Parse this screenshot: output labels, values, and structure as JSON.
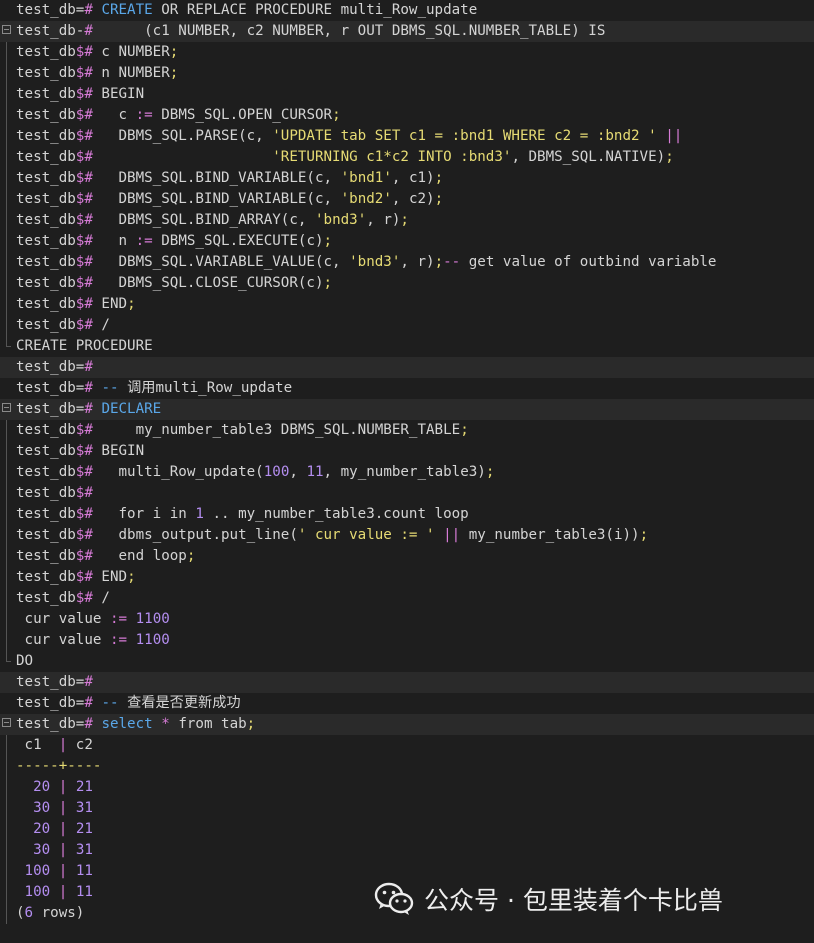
{
  "terminal": {
    "lines": [
      {
        "fold": "",
        "hl": false,
        "tokens": [
          [
            "prompt",
            "test_db="
          ],
          [
            "op",
            "#"
          ],
          [
            "text",
            " "
          ],
          [
            "kw",
            "CREATE"
          ],
          [
            "text",
            " OR REPLACE PROCEDURE multi_Row_update"
          ]
        ]
      },
      {
        "fold": "start",
        "hl": true,
        "tokens": [
          [
            "prompt",
            "test_db-"
          ],
          [
            "op",
            "#"
          ],
          [
            "text",
            "      (c1 NUMBER, c2 NUMBER, r OUT DBMS_SQL.NUMBER_TABLE) IS"
          ]
        ]
      },
      {
        "fold": "mid",
        "hl": false,
        "tokens": [
          [
            "prompt",
            "test_db"
          ],
          [
            "op",
            "$#"
          ],
          [
            "text",
            " c NUMBER"
          ],
          [
            "punc",
            ";"
          ]
        ]
      },
      {
        "fold": "mid",
        "hl": false,
        "tokens": [
          [
            "prompt",
            "test_db"
          ],
          [
            "op",
            "$#"
          ],
          [
            "text",
            " n NUMBER"
          ],
          [
            "punc",
            ";"
          ]
        ]
      },
      {
        "fold": "mid",
        "hl": false,
        "tokens": [
          [
            "prompt",
            "test_db"
          ],
          [
            "op",
            "$#"
          ],
          [
            "text",
            " BEGIN"
          ]
        ]
      },
      {
        "fold": "mid",
        "hl": false,
        "tokens": [
          [
            "prompt",
            "test_db"
          ],
          [
            "op",
            "$#"
          ],
          [
            "text",
            "   c "
          ],
          [
            "op",
            ":="
          ],
          [
            "text",
            " DBMS_SQL.OPEN_CURSOR"
          ],
          [
            "punc",
            ";"
          ]
        ]
      },
      {
        "fold": "mid",
        "hl": false,
        "tokens": [
          [
            "prompt",
            "test_db"
          ],
          [
            "op",
            "$#"
          ],
          [
            "text",
            "   DBMS_SQL.PARSE(c, "
          ],
          [
            "str",
            "'UPDATE tab SET c1 = :bnd1 WHERE c2 = :bnd2 '"
          ],
          [
            "text",
            " "
          ],
          [
            "op",
            "||"
          ]
        ]
      },
      {
        "fold": "mid",
        "hl": false,
        "tokens": [
          [
            "prompt",
            "test_db"
          ],
          [
            "op",
            "$#"
          ],
          [
            "text",
            "                     "
          ],
          [
            "str",
            "'RETURNING c1*c2 INTO :bnd3'"
          ],
          [
            "text",
            ", DBMS_SQL.NATIVE)"
          ],
          [
            "punc",
            ";"
          ]
        ]
      },
      {
        "fold": "mid",
        "hl": false,
        "tokens": [
          [
            "prompt",
            "test_db"
          ],
          [
            "op",
            "$#"
          ],
          [
            "text",
            "   DBMS_SQL.BIND_VARIABLE(c, "
          ],
          [
            "str",
            "'bnd1'"
          ],
          [
            "text",
            ", c1)"
          ],
          [
            "punc",
            ";"
          ]
        ]
      },
      {
        "fold": "mid",
        "hl": false,
        "tokens": [
          [
            "prompt",
            "test_db"
          ],
          [
            "op",
            "$#"
          ],
          [
            "text",
            "   DBMS_SQL.BIND_VARIABLE(c, "
          ],
          [
            "str",
            "'bnd2'"
          ],
          [
            "text",
            ", c2)"
          ],
          [
            "punc",
            ";"
          ]
        ]
      },
      {
        "fold": "mid",
        "hl": false,
        "tokens": [
          [
            "prompt",
            "test_db"
          ],
          [
            "op",
            "$#"
          ],
          [
            "text",
            "   DBMS_SQL.BIND_ARRAY(c, "
          ],
          [
            "str",
            "'bnd3'"
          ],
          [
            "text",
            ", r)"
          ],
          [
            "punc",
            ";"
          ]
        ]
      },
      {
        "fold": "mid",
        "hl": false,
        "tokens": [
          [
            "prompt",
            "test_db"
          ],
          [
            "op",
            "$#"
          ],
          [
            "text",
            "   n "
          ],
          [
            "op",
            ":="
          ],
          [
            "text",
            " DBMS_SQL.EXECUTE(c)"
          ],
          [
            "punc",
            ";"
          ]
        ]
      },
      {
        "fold": "mid",
        "hl": false,
        "tokens": [
          [
            "prompt",
            "test_db"
          ],
          [
            "op",
            "$#"
          ],
          [
            "text",
            "   DBMS_SQL.VARIABLE_VALUE(c, "
          ],
          [
            "str",
            "'bnd3'"
          ],
          [
            "text",
            ", r)"
          ],
          [
            "punc",
            ";"
          ],
          [
            "op",
            "--"
          ],
          [
            "text",
            " get value of outbind variable"
          ]
        ]
      },
      {
        "fold": "mid",
        "hl": false,
        "tokens": [
          [
            "prompt",
            "test_db"
          ],
          [
            "op",
            "$#"
          ],
          [
            "text",
            "   DBMS_SQL.CLOSE_CURSOR(c)"
          ],
          [
            "punc",
            ";"
          ]
        ]
      },
      {
        "fold": "mid",
        "hl": false,
        "tokens": [
          [
            "prompt",
            "test_db"
          ],
          [
            "op",
            "$#"
          ],
          [
            "text",
            " END"
          ],
          [
            "punc",
            ";"
          ]
        ]
      },
      {
        "fold": "mid",
        "hl": false,
        "tokens": [
          [
            "prompt",
            "test_db"
          ],
          [
            "op",
            "$#"
          ],
          [
            "text",
            " /"
          ]
        ]
      },
      {
        "fold": "end",
        "hl": false,
        "tokens": [
          [
            "text",
            "CREATE PROCEDURE"
          ]
        ]
      },
      {
        "fold": "",
        "hl": true,
        "tokens": [
          [
            "prompt",
            "test_db="
          ],
          [
            "op",
            "#"
          ]
        ]
      },
      {
        "fold": "",
        "hl": false,
        "tokens": [
          [
            "prompt",
            "test_db="
          ],
          [
            "op",
            "#"
          ],
          [
            "text",
            " "
          ],
          [
            "cm",
            "--"
          ],
          [
            "text",
            " 调用multi_Row_update"
          ]
        ]
      },
      {
        "fold": "start",
        "hl": true,
        "tokens": [
          [
            "prompt",
            "test_db="
          ],
          [
            "op",
            "#"
          ],
          [
            "text",
            " "
          ],
          [
            "kw",
            "DECLARE"
          ]
        ]
      },
      {
        "fold": "mid",
        "hl": false,
        "tokens": [
          [
            "prompt",
            "test_db"
          ],
          [
            "op",
            "$#"
          ],
          [
            "text",
            "     my_number_table3 DBMS_SQL.NUMBER_TABLE"
          ],
          [
            "punc",
            ";"
          ]
        ]
      },
      {
        "fold": "mid",
        "hl": false,
        "tokens": [
          [
            "prompt",
            "test_db"
          ],
          [
            "op",
            "$#"
          ],
          [
            "text",
            " BEGIN"
          ]
        ]
      },
      {
        "fold": "mid",
        "hl": false,
        "tokens": [
          [
            "prompt",
            "test_db"
          ],
          [
            "op",
            "$#"
          ],
          [
            "text",
            "   multi_Row_update("
          ],
          [
            "num",
            "100"
          ],
          [
            "text",
            ", "
          ],
          [
            "num",
            "11"
          ],
          [
            "text",
            ", my_number_table3)"
          ],
          [
            "punc",
            ";"
          ]
        ]
      },
      {
        "fold": "mid",
        "hl": false,
        "tokens": [
          [
            "prompt",
            "test_db"
          ],
          [
            "op",
            "$#"
          ]
        ]
      },
      {
        "fold": "mid",
        "hl": false,
        "tokens": [
          [
            "prompt",
            "test_db"
          ],
          [
            "op",
            "$#"
          ],
          [
            "text",
            "   for i in "
          ],
          [
            "num",
            "1"
          ],
          [
            "text",
            " .. my_number_table3.count loop"
          ]
        ]
      },
      {
        "fold": "mid",
        "hl": false,
        "tokens": [
          [
            "prompt",
            "test_db"
          ],
          [
            "op",
            "$#"
          ],
          [
            "text",
            "   dbms_output.put_line("
          ],
          [
            "str",
            "' cur value := '"
          ],
          [
            "text",
            " "
          ],
          [
            "op",
            "||"
          ],
          [
            "text",
            " my_number_table3(i))"
          ],
          [
            "punc",
            ";"
          ]
        ]
      },
      {
        "fold": "mid",
        "hl": false,
        "tokens": [
          [
            "prompt",
            "test_db"
          ],
          [
            "op",
            "$#"
          ],
          [
            "text",
            "   end loop"
          ],
          [
            "punc",
            ";"
          ]
        ]
      },
      {
        "fold": "mid",
        "hl": false,
        "tokens": [
          [
            "prompt",
            "test_db"
          ],
          [
            "op",
            "$#"
          ],
          [
            "text",
            " END"
          ],
          [
            "punc",
            ";"
          ]
        ]
      },
      {
        "fold": "mid",
        "hl": false,
        "tokens": [
          [
            "prompt",
            "test_db"
          ],
          [
            "op",
            "$#"
          ],
          [
            "text",
            " /"
          ]
        ]
      },
      {
        "fold": "mid",
        "hl": false,
        "tokens": [
          [
            "text",
            " cur value "
          ],
          [
            "op",
            ":="
          ],
          [
            "text",
            " "
          ],
          [
            "num",
            "1100"
          ]
        ]
      },
      {
        "fold": "mid",
        "hl": false,
        "tokens": [
          [
            "text",
            " cur value "
          ],
          [
            "op",
            ":="
          ],
          [
            "text",
            " "
          ],
          [
            "num",
            "1100"
          ]
        ]
      },
      {
        "fold": "end",
        "hl": false,
        "tokens": [
          [
            "text",
            "DO"
          ]
        ]
      },
      {
        "fold": "",
        "hl": true,
        "tokens": [
          [
            "prompt",
            "test_db="
          ],
          [
            "op",
            "#"
          ]
        ]
      },
      {
        "fold": "",
        "hl": false,
        "tokens": [
          [
            "prompt",
            "test_db="
          ],
          [
            "op",
            "#"
          ],
          [
            "text",
            " "
          ],
          [
            "cm",
            "--"
          ],
          [
            "text",
            " 查看是否更新成功"
          ]
        ]
      },
      {
        "fold": "start",
        "hl": true,
        "tokens": [
          [
            "prompt",
            "test_db="
          ],
          [
            "op",
            "#"
          ],
          [
            "text",
            " "
          ],
          [
            "kw",
            "select"
          ],
          [
            "text",
            " "
          ],
          [
            "op",
            "*"
          ],
          [
            "text",
            " from tab"
          ],
          [
            "punc",
            ";"
          ]
        ]
      },
      {
        "fold": "mid",
        "hl": false,
        "tokens": [
          [
            "text",
            " c1  "
          ],
          [
            "op",
            "|"
          ],
          [
            "text",
            " c2"
          ]
        ]
      },
      {
        "fold": "mid",
        "hl": false,
        "tokens": [
          [
            "dash",
            "-----+----"
          ]
        ]
      },
      {
        "fold": "mid",
        "hl": false,
        "tokens": [
          [
            "text",
            "  "
          ],
          [
            "num",
            "20"
          ],
          [
            "text",
            " "
          ],
          [
            "op",
            "|"
          ],
          [
            "text",
            " "
          ],
          [
            "num",
            "21"
          ]
        ]
      },
      {
        "fold": "mid",
        "hl": false,
        "tokens": [
          [
            "text",
            "  "
          ],
          [
            "num",
            "30"
          ],
          [
            "text",
            " "
          ],
          [
            "op",
            "|"
          ],
          [
            "text",
            " "
          ],
          [
            "num",
            "31"
          ]
        ]
      },
      {
        "fold": "mid",
        "hl": false,
        "tokens": [
          [
            "text",
            "  "
          ],
          [
            "num",
            "20"
          ],
          [
            "text",
            " "
          ],
          [
            "op",
            "|"
          ],
          [
            "text",
            " "
          ],
          [
            "num",
            "21"
          ]
        ]
      },
      {
        "fold": "mid",
        "hl": false,
        "tokens": [
          [
            "text",
            "  "
          ],
          [
            "num",
            "30"
          ],
          [
            "text",
            " "
          ],
          [
            "op",
            "|"
          ],
          [
            "text",
            " "
          ],
          [
            "num",
            "31"
          ]
        ]
      },
      {
        "fold": "mid",
        "hl": false,
        "tokens": [
          [
            "text",
            " "
          ],
          [
            "num",
            "100"
          ],
          [
            "text",
            " "
          ],
          [
            "op",
            "|"
          ],
          [
            "text",
            " "
          ],
          [
            "num",
            "11"
          ]
        ]
      },
      {
        "fold": "mid",
        "hl": false,
        "tokens": [
          [
            "text",
            " "
          ],
          [
            "num",
            "100"
          ],
          [
            "text",
            " "
          ],
          [
            "op",
            "|"
          ],
          [
            "text",
            " "
          ],
          [
            "num",
            "11"
          ]
        ]
      },
      {
        "fold": "mid",
        "hl": false,
        "tokens": [
          [
            "text",
            "("
          ],
          [
            "num",
            "6"
          ],
          [
            "text",
            " rows)"
          ]
        ]
      }
    ]
  },
  "watermark": {
    "text": "公众号 · 包里装着个卡比兽",
    "icon": "wechat-icon"
  },
  "colors": {
    "background": "#1e1e1e",
    "keyword": "#5aa7e8",
    "string": "#e6db74",
    "number": "#b48ef0",
    "operator": "#d67bd6"
  }
}
